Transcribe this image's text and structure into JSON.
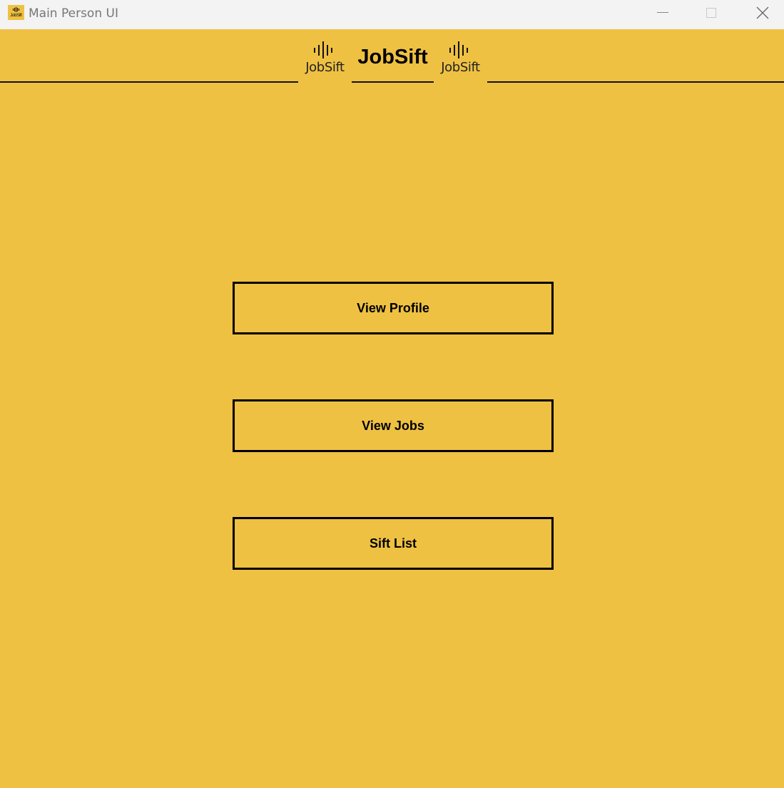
{
  "window": {
    "title": "Main Person UI",
    "app_icon_text": "JobSift",
    "controls": {
      "minimize": "minimize-icon",
      "maximize": "maximize-icon",
      "close": "close-icon"
    }
  },
  "header": {
    "title": "JobSift",
    "logo_left_text": "JobSift",
    "logo_right_text": "JobSift",
    "logo_icon": "soundwave-icon"
  },
  "menu": {
    "view_profile": "View Profile",
    "view_jobs": "View Jobs",
    "sift_list": "Sift List"
  },
  "colors": {
    "background": "#EFC143",
    "titlebar": "#F3F3F3",
    "border": "#000000"
  }
}
